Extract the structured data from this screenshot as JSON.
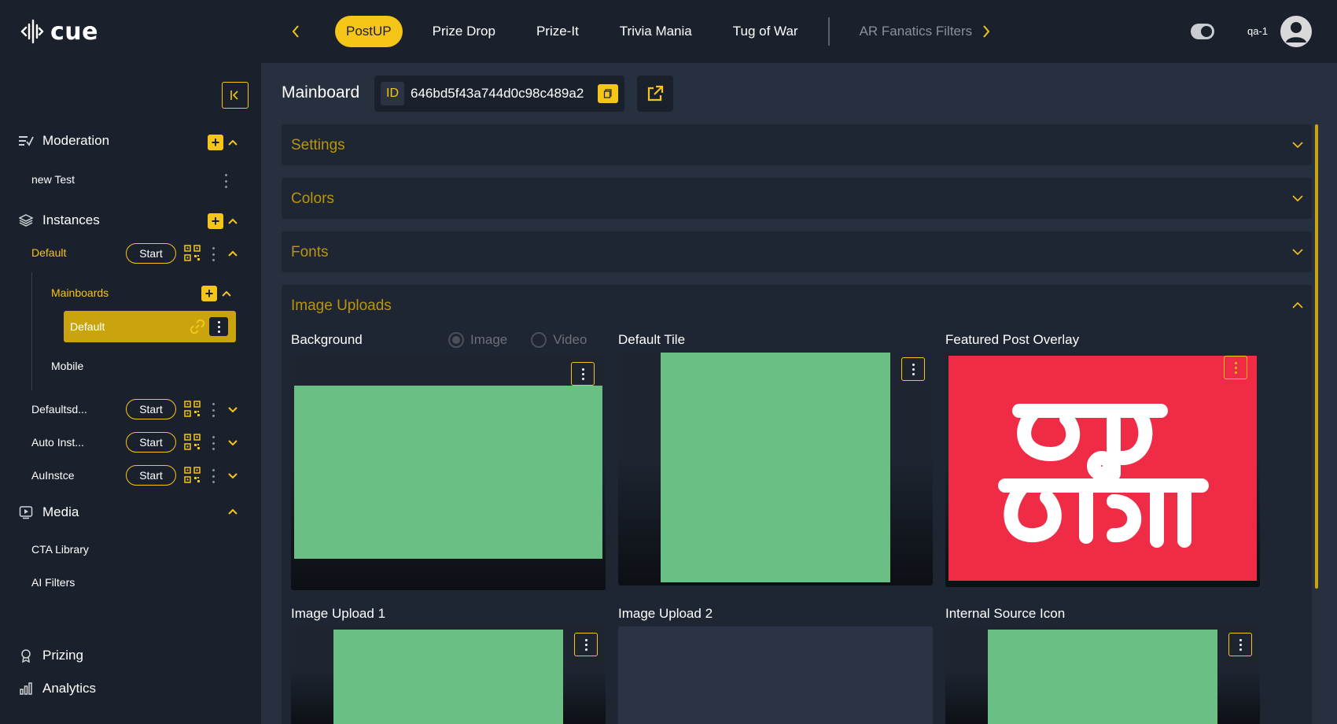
{
  "app": {
    "logo_text": "cue"
  },
  "topnav": {
    "tabs": [
      {
        "label": "PostUP",
        "active": true
      },
      {
        "label": "Prize Drop"
      },
      {
        "label": "Prize-It"
      },
      {
        "label": "Trivia Mania"
      },
      {
        "label": "Tug of War"
      },
      {
        "label": "AR Fanatics Filters",
        "disabled": true
      }
    ],
    "username": "qa-1"
  },
  "sidebar": {
    "moderation": {
      "label": "Moderation",
      "items": [
        {
          "label": "new Test"
        }
      ]
    },
    "instances": {
      "label": "Instances",
      "items": [
        {
          "label": "Default",
          "start_label": "Start"
        },
        {
          "label": "Defaultsd...",
          "start_label": "Start"
        },
        {
          "label": "Auto Inst...",
          "start_label": "Start"
        },
        {
          "label": "AuInstce",
          "start_label": "Start"
        }
      ],
      "mainboards": {
        "label": "Mainboards",
        "active_item": "Default"
      },
      "mobile": {
        "label": "Mobile"
      }
    },
    "media": {
      "label": "Media",
      "items": [
        {
          "label": "CTA Library"
        },
        {
          "label": "AI Filters"
        }
      ]
    },
    "prizing": {
      "label": "Prizing"
    },
    "analytics": {
      "label": "Analytics"
    }
  },
  "main": {
    "title": "Mainboard",
    "id_badge": "ID",
    "id_value": "646bd5f43a744d0c98c489a2",
    "panels": {
      "settings": "Settings",
      "colors": "Colors",
      "fonts": "Fonts",
      "image_uploads": "Image Uploads"
    },
    "uploads": {
      "background": "Background",
      "radio_image": "Image",
      "radio_video": "Video",
      "default_tile": "Default Tile",
      "featured_overlay": "Featured Post Overlay",
      "image_upload_1": "Image Upload 1",
      "image_upload_2": "Image Upload 2",
      "internal_source_icon": "Internal Source Icon"
    }
  },
  "colors": {
    "accent": "#f5c518",
    "background": "#1b212c",
    "panel": "#1f2633",
    "main": "#27303f",
    "placeholder_green": "#69bf84",
    "overlay_red": "#ef2b45"
  }
}
